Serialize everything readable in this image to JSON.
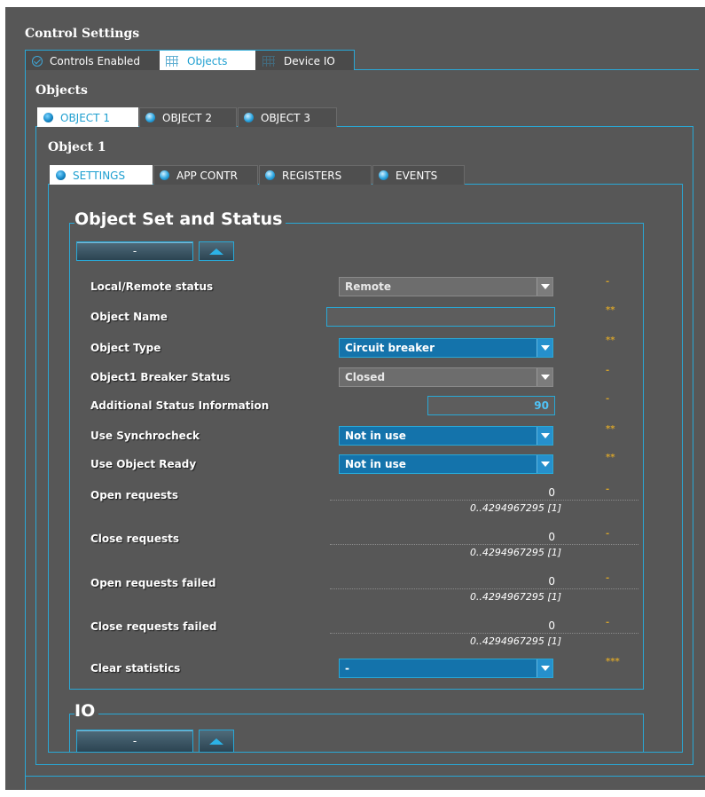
{
  "header": {
    "title": "Control Settings"
  },
  "main_tabs": [
    {
      "label": "Controls Enabled",
      "icon": "check-circle-icon"
    },
    {
      "label": "Objects",
      "icon": "grid-icon"
    },
    {
      "label": "Device IO",
      "icon": "grid-icon"
    }
  ],
  "objects_section": {
    "title": "Objects"
  },
  "object_tabs": [
    {
      "label": "OBJECT 1"
    },
    {
      "label": "OBJECT 2"
    },
    {
      "label": "OBJECT 3"
    }
  ],
  "object_panel": {
    "title": "Object 1"
  },
  "sub_tabs": [
    {
      "label": "SETTINGS"
    },
    {
      "label": "APP CONTR"
    },
    {
      "label": "REGISTERS"
    },
    {
      "label": "EVENTS"
    }
  ],
  "status_group": {
    "title": "Object Set and Status",
    "collapse_label": "-"
  },
  "fields": {
    "local_remote": {
      "label": "Local/Remote status",
      "value": "Remote",
      "mark": "-"
    },
    "object_name": {
      "label": "Object Name",
      "value": "",
      "mark": "**"
    },
    "object_type": {
      "label": "Object Type",
      "value": "Circuit breaker",
      "mark": "**"
    },
    "breaker_status": {
      "label": "Object1 Breaker Status",
      "value": "Closed",
      "mark": "-"
    },
    "additional_status": {
      "label": "Additional Status Information",
      "value": "90",
      "mark": "-"
    },
    "use_synchrocheck": {
      "label": "Use Synchrocheck",
      "value": "Not in use",
      "mark": "**"
    },
    "use_object_ready": {
      "label": "Use Object Ready",
      "value": "Not in use",
      "mark": "**"
    },
    "open_requests": {
      "label": "Open requests",
      "value": "0",
      "range": "0..4294967295 [1]",
      "mark": "-"
    },
    "close_requests": {
      "label": "Close requests",
      "value": "0",
      "range": "0..4294967295 [1]",
      "mark": "-"
    },
    "open_requests_failed": {
      "label": "Open requests failed",
      "value": "0",
      "range": "0..4294967295 [1]",
      "mark": "-"
    },
    "close_requests_failed": {
      "label": "Close requests failed",
      "value": "0",
      "range": "0..4294967295 [1]",
      "mark": "-"
    },
    "clear_statistics": {
      "label": "Clear statistics",
      "value": "-",
      "mark": "***"
    }
  },
  "io_group": {
    "title": "IO",
    "collapse_label": "-"
  },
  "colors": {
    "accent": "#29a8d6",
    "background": "#575757",
    "select_fill": "#1473ab",
    "mark": "#d4a22c"
  }
}
